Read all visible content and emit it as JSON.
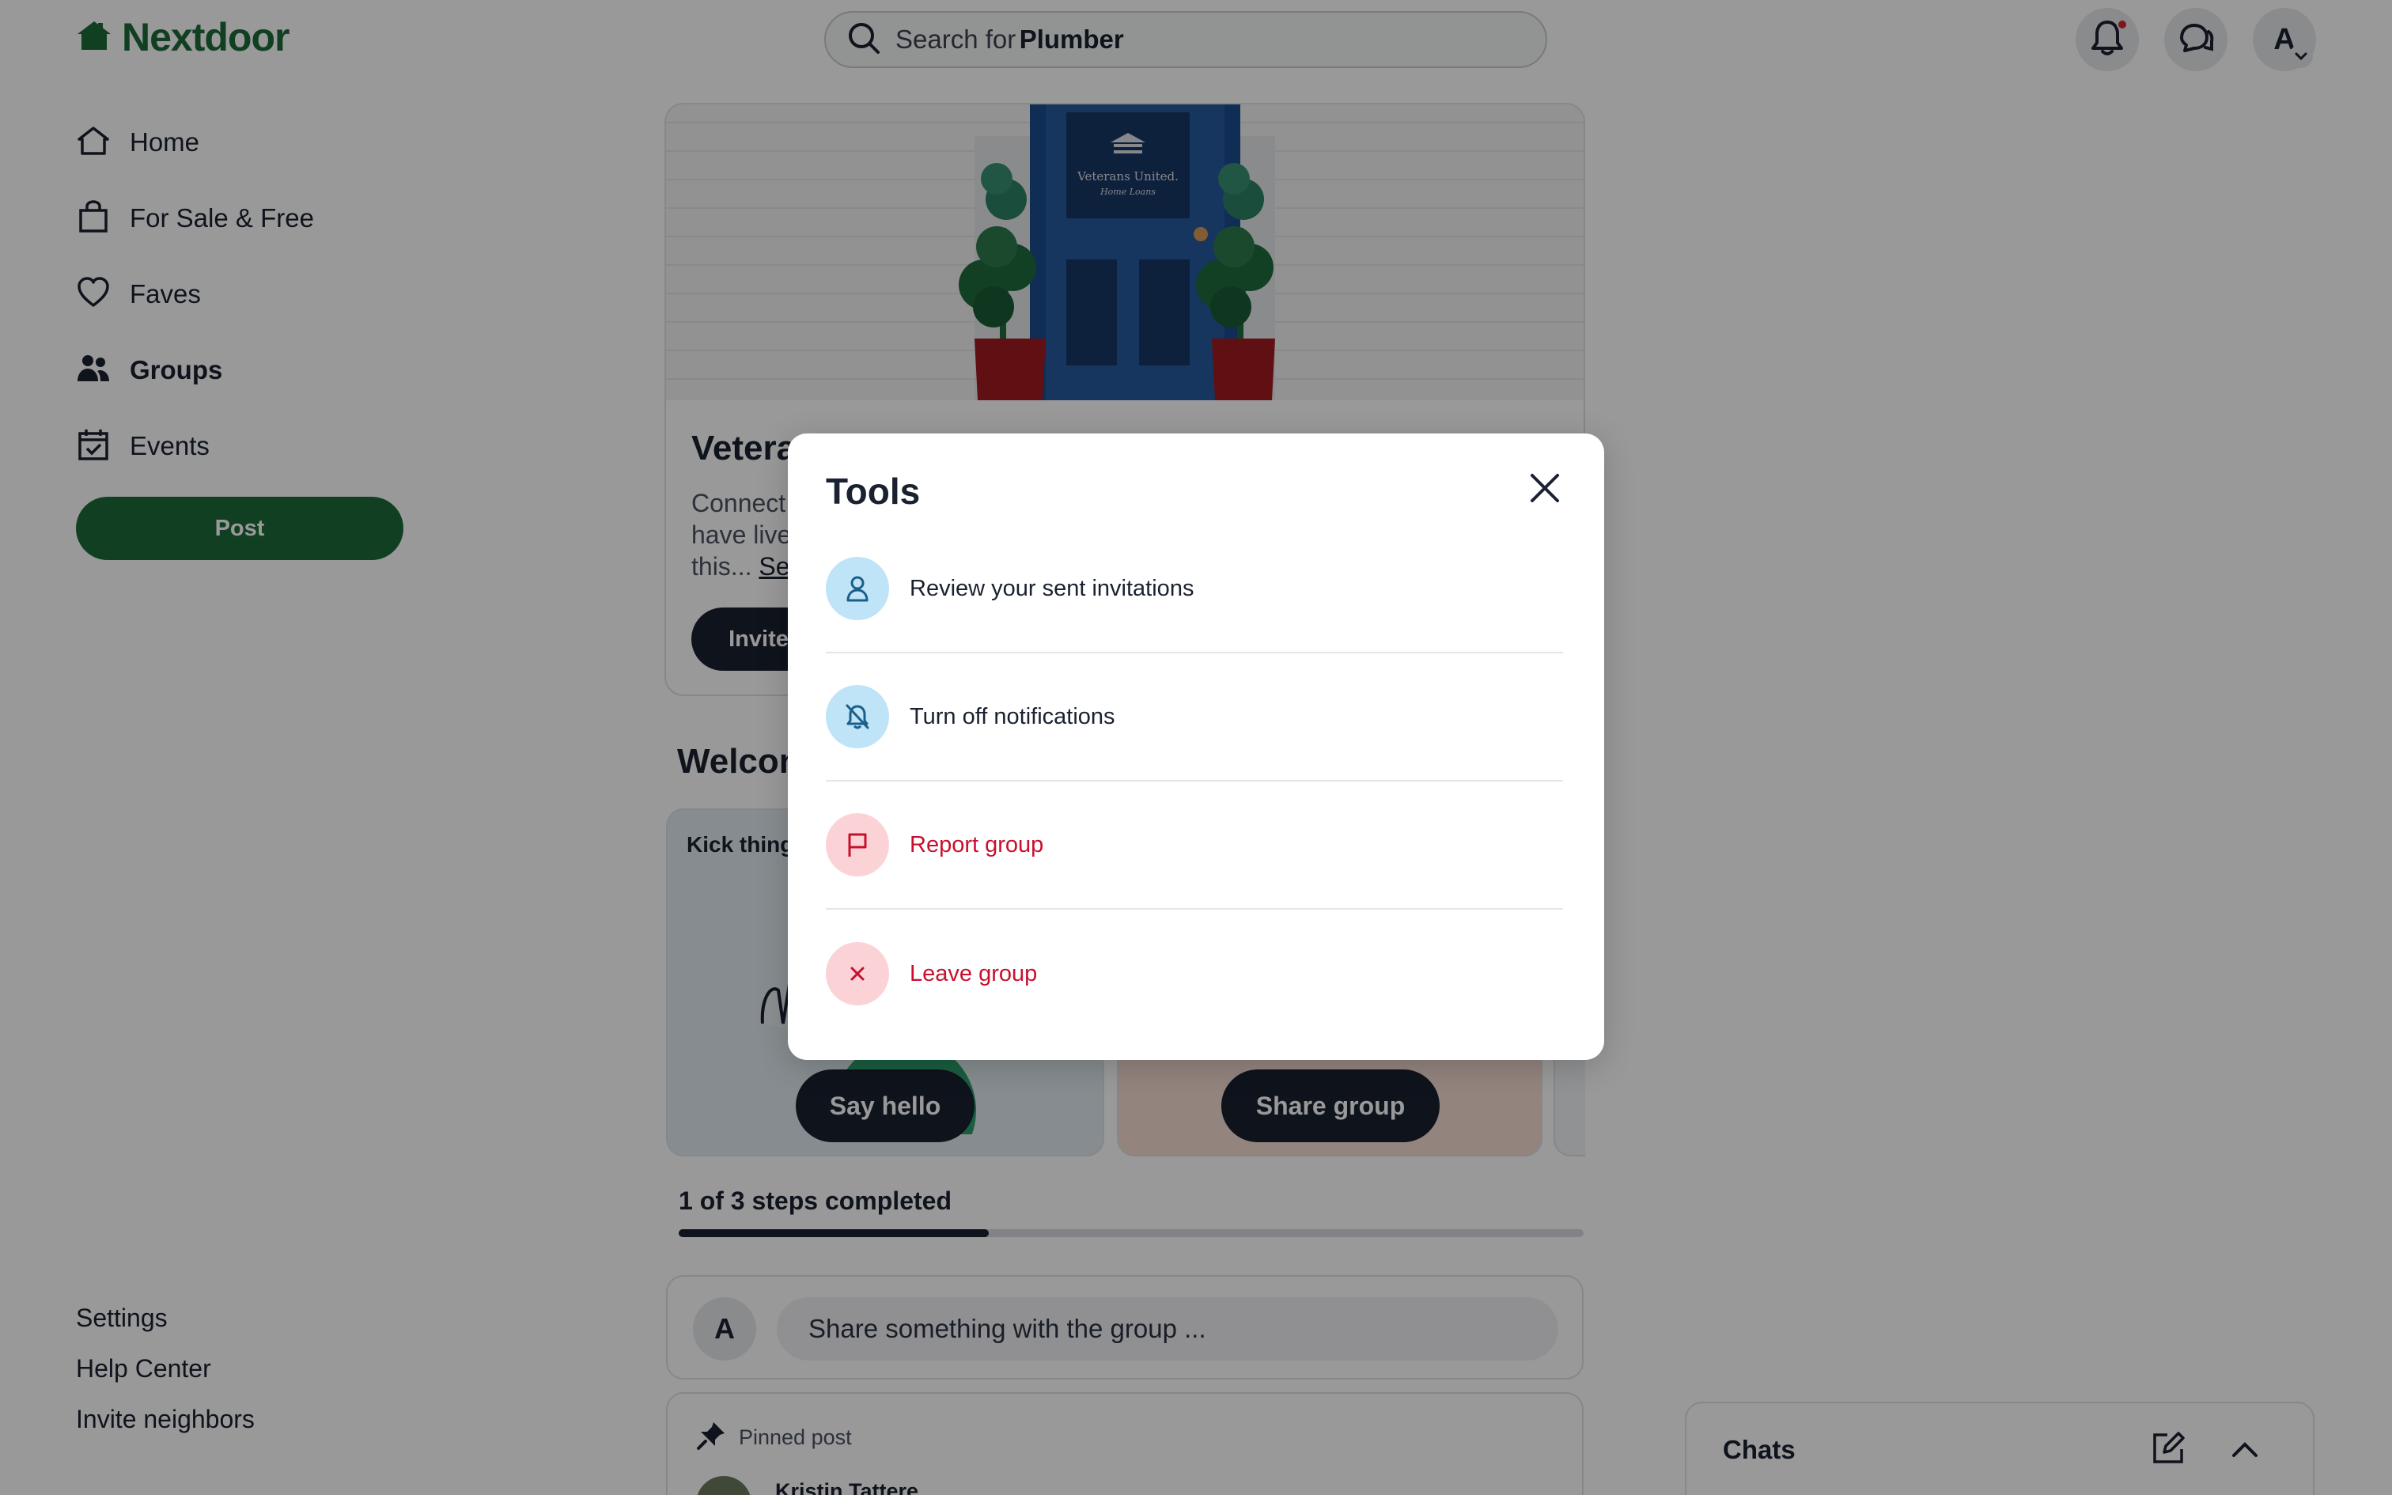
{
  "header": {
    "logo_text": "Nextdoor",
    "search_prefix": "Search for",
    "search_term": "Plumber",
    "avatar_initial": "A"
  },
  "sidebar": {
    "items": [
      {
        "label": "Home",
        "icon": "home-icon"
      },
      {
        "label": "For Sale & Free",
        "icon": "shopping-bag-icon"
      },
      {
        "label": "Faves",
        "icon": "heart-icon"
      },
      {
        "label": "Groups",
        "icon": "groups-icon",
        "active": true
      },
      {
        "label": "Events",
        "icon": "calendar-icon"
      }
    ],
    "post_label": "Post",
    "footer": [
      "Settings",
      "Help Center",
      "Invite neighbors"
    ]
  },
  "hero": {
    "sign_line1": "Veterans United.",
    "sign_line2": "Home Loans",
    "title": "Vetera",
    "desc_line1": "Connect",
    "desc_line2": "have live",
    "desc_line3": "this...",
    "see_more": "See",
    "invite_label": "Invite"
  },
  "welcome": {
    "title": "Welcon",
    "kick_text": "Kick thing",
    "say_hello": "Say hello",
    "share_group": "Share group",
    "progress_label": "1 of 3 steps completed",
    "progress_fraction": 0.343
  },
  "composer": {
    "avatar_initial": "A",
    "placeholder": "Share something with the group ..."
  },
  "pinned": {
    "label": "Pinned post",
    "author": "Kristin Tattere"
  },
  "chats": {
    "title": "Chats"
  },
  "modal": {
    "title": "Tools",
    "items": [
      {
        "label": "Review your sent invitations",
        "icon": "person-icon",
        "tone": "blue"
      },
      {
        "label": "Turn off notifications",
        "icon": "bell-off-icon",
        "tone": "blue"
      },
      {
        "label": "Report group",
        "icon": "flag-icon",
        "tone": "red"
      },
      {
        "label": "Leave group",
        "icon": "x-icon",
        "tone": "red"
      }
    ]
  },
  "colors": {
    "brand_green": "#1b6b38",
    "dark": "#1a2130",
    "danger": "#c8102e",
    "icon_blue_bg": "#bfe3f7",
    "icon_red_bg": "#fbd3d6"
  }
}
